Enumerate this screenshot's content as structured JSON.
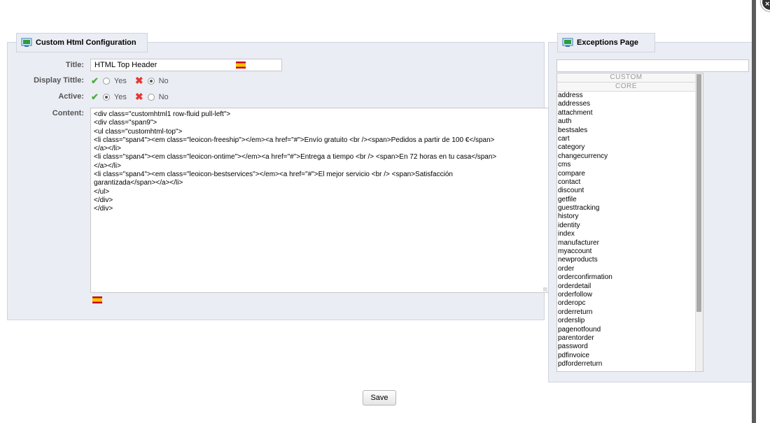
{
  "left_panel": {
    "legend": "Custom Html Configuration",
    "title_label": "Title:",
    "title_value": "HTML Top Header",
    "display_title_label": "Display Tittle:",
    "active_label": "Active:",
    "yes_label": "Yes",
    "no_label": "No",
    "content_label": "Content:",
    "content_value": "<div class=\"customhtml1 row-fluid pull-left\">\n<div class=\"span9\">\n<ul class=\"customhtml-top\">\n<li class=\"span4\"><em class=\"leoicon-freeship\"></em><a href=\"#\">Envío gratuito <br /><span>Pedidos a partir de 100 €</span>\n</a></li>\n<li class=\"span4\"><em class=\"leoicon-ontime\"></em><a href=\"#\">Entrega a tiempo <br /> <span>En 72 horas en tu casa</span>\n</a></li>\n<li class=\"span4\"><em class=\"leoicon-bestservices\"></em><a href=\"#\">El mejor servicio <br /> <span>Satisfacción\ngarantizada</span></a></li>\n</ul>\n</div>\n</div>"
  },
  "right_panel": {
    "legend": "Exceptions Page",
    "search_value": "",
    "group_custom": "CUSTOM",
    "group_core": "CORE",
    "pages": [
      "address",
      "addresses",
      "attachment",
      "auth",
      "bestsales",
      "cart",
      "category",
      "changecurrency",
      "cms",
      "compare",
      "contact",
      "discount",
      "getfile",
      "guesttracking",
      "history",
      "identity",
      "index",
      "manufacturer",
      "myaccount",
      "newproducts",
      "order",
      "orderconfirmation",
      "orderdetail",
      "orderfollow",
      "orderopc",
      "orderreturn",
      "orderslip",
      "pagenotfound",
      "parentorder",
      "password",
      "pdfinvoice",
      "pdforderreturn"
    ]
  },
  "save_label": "Save",
  "colors": {
    "panel_bg": "#ebedf4",
    "check": "#4caf3a",
    "cross": "#e53935"
  },
  "icons": {
    "legend": "monitor-icon",
    "flag": "spain-flag-icon"
  }
}
